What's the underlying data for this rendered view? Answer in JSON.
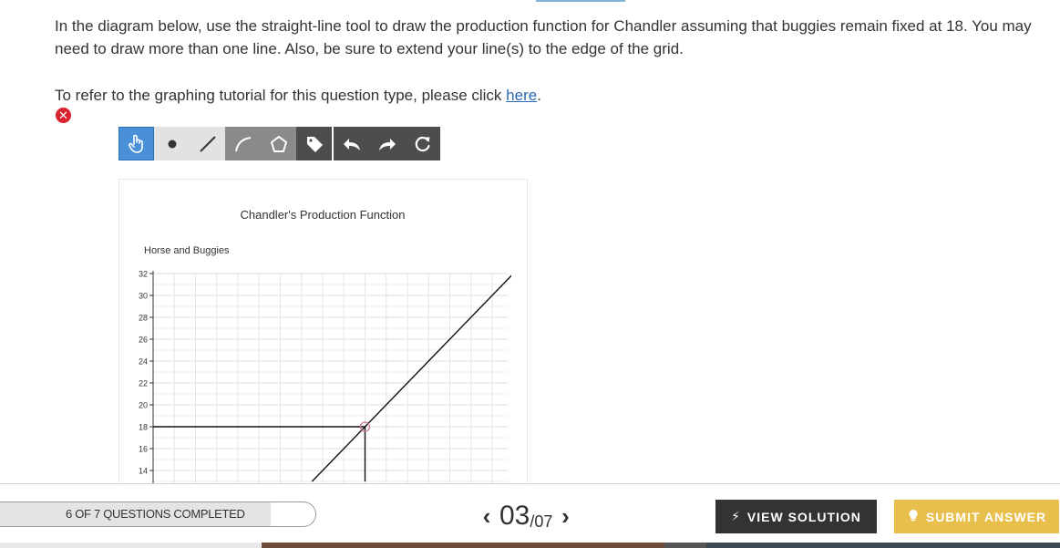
{
  "question": {
    "text": "In the diagram below, use the straight-line tool to draw the production function for Chandler assuming that buggies remain fixed at 18. You may need to draw more than one line. Also, be sure to extend your line(s) to the edge of the grid.",
    "tutorial_prefix": "To refer to the graphing tutorial for this question type, please click ",
    "tutorial_link": "here",
    "tutorial_suffix": ".",
    "status_icon": "error-x-icon"
  },
  "toolbar": {
    "tools": [
      {
        "name": "select",
        "icon": "hand-pointer-icon",
        "active": true
      },
      {
        "name": "point",
        "icon": "point-icon"
      },
      {
        "name": "line",
        "icon": "line-icon"
      },
      {
        "name": "curve",
        "icon": "curve-icon"
      },
      {
        "name": "polygon",
        "icon": "polygon-icon"
      },
      {
        "name": "label",
        "icon": "tag-icon"
      },
      {
        "name": "undo",
        "icon": "undo-icon"
      },
      {
        "name": "redo",
        "icon": "redo-icon"
      },
      {
        "name": "reset",
        "icon": "reset-icon"
      }
    ]
  },
  "chart_data": {
    "type": "line",
    "title": "Chandler's Production Function",
    "ylabel": "Horse and Buggies",
    "y_ticks": [
      "32",
      "30",
      "28",
      "26",
      "24",
      "22",
      "20",
      "18",
      "16",
      "14"
    ],
    "ylim": [
      13,
      32
    ],
    "xlim": [
      0,
      18
    ],
    "grid": true,
    "series": [
      {
        "points": [
          [
            0,
            18
          ],
          [
            10,
            18
          ]
        ]
      },
      {
        "points": [
          [
            10,
            13
          ],
          [
            10,
            18
          ]
        ]
      },
      {
        "points": [
          [
            7.5,
            13
          ],
          [
            10,
            18
          ],
          [
            17,
            32
          ]
        ]
      }
    ],
    "marked_point": [
      10,
      18
    ]
  },
  "footer": {
    "progress_label": "6 OF 7 QUESTIONS COMPLETED",
    "progress_fraction": 0.857,
    "current_page": "03",
    "total_pages": "/07",
    "view_solution": "VIEW SOLUTION",
    "submit_answer": "SUBMIT ANSWER"
  }
}
